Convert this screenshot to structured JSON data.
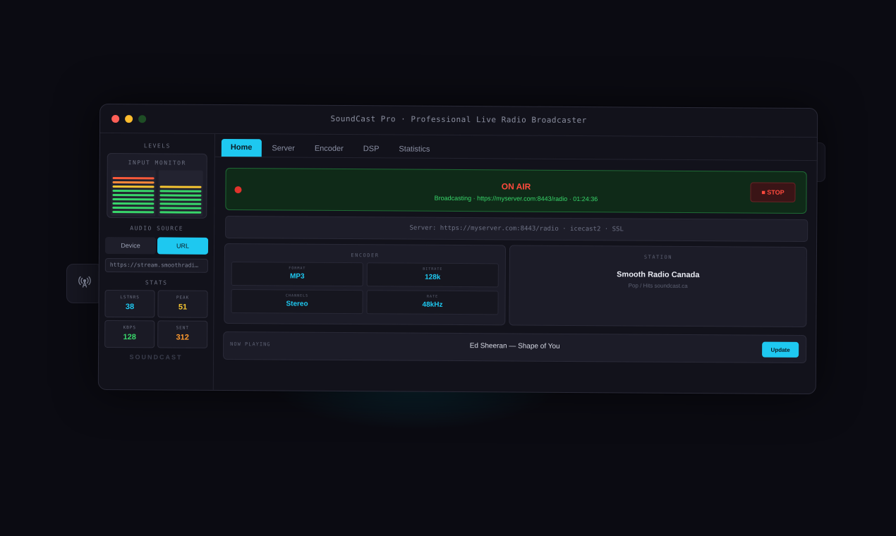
{
  "window": {
    "title": "SoundCast Pro · Professional Live Radio Broadcaster"
  },
  "colors": {
    "accent": "#1ec8f0",
    "on_air_red": "#ff4a3d",
    "status_green": "#38d66a"
  },
  "sidebar": {
    "levels_label": "LEVELS",
    "monitor_label": "INPUT MONITOR",
    "meters": [
      {
        "channel": "left",
        "level": 0.85
      },
      {
        "channel": "right",
        "level": 0.65
      }
    ],
    "audio_source_label": "AUDIO SOURCE",
    "source_options": [
      "Device",
      "URL"
    ],
    "source_selected": "URL",
    "url_value": "https://stream.smoothradi…",
    "stats_label": "STATS",
    "stats": [
      {
        "key": "LSTNRS",
        "value": "38",
        "color": "#1ec8f0"
      },
      {
        "key": "PEAK",
        "value": "51",
        "color": "#f5c531"
      },
      {
        "key": "KBPS",
        "value": "128",
        "color": "#38d66a"
      },
      {
        "key": "SENT",
        "value": "312",
        "color": "#ff9a2e"
      }
    ],
    "brand": "SOUNDCAST"
  },
  "tabs": [
    "Home",
    "Server",
    "Encoder",
    "DSP",
    "Statistics"
  ],
  "active_tab": "Home",
  "on_air": {
    "title": "ON AIR",
    "subtitle": "Broadcasting · https://myserver.com:8443/radio · 01:24:36",
    "stop_label": "■ STOP"
  },
  "server_bar": "Server: https://myserver.com:8443/radio · icecast2 · SSL",
  "encoder": {
    "label": "ENCODER",
    "cells": [
      {
        "key": "FORMAT",
        "value": "MP3"
      },
      {
        "key": "BITRATE",
        "value": "128k"
      },
      {
        "key": "CHANNELS",
        "value": "Stereo"
      },
      {
        "key": "RATE",
        "value": "48kHz"
      }
    ]
  },
  "station": {
    "label": "STATION",
    "name": "Smooth Radio Canada",
    "genre": "Pop / Hits  soundcast.ca"
  },
  "now_playing": {
    "label": "NOW PLAYING",
    "song": "Ed Sheeran — Shape of You",
    "update_label": "Update"
  }
}
